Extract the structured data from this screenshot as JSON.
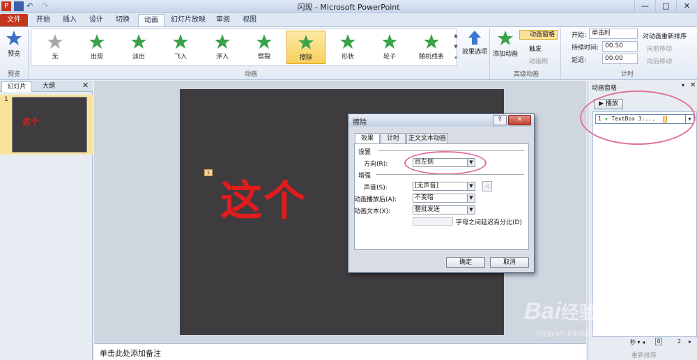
{
  "window": {
    "title": "闪现 - Microsoft PowerPoint",
    "controls": [
      "—",
      "□",
      "✕"
    ]
  },
  "tabs": [
    {
      "label": "文件"
    },
    {
      "label": "开始"
    },
    {
      "label": "插入"
    },
    {
      "label": "设计"
    },
    {
      "label": "切换"
    },
    {
      "label": "动画"
    },
    {
      "label": "幻灯片放映"
    },
    {
      "label": "审阅"
    },
    {
      "label": "视图"
    }
  ],
  "ribbon": {
    "preview": {
      "label": "预览",
      "group": "预览"
    },
    "animations": [
      {
        "label": "无",
        "color": "#a8a8a8"
      },
      {
        "label": "出现",
        "color": "#3aa34a"
      },
      {
        "label": "淡出",
        "color": "#3aa34a"
      },
      {
        "label": "飞入",
        "color": "#3aa34a"
      },
      {
        "label": "浮入",
        "color": "#3aa34a"
      },
      {
        "label": "劈裂",
        "color": "#3aa34a"
      },
      {
        "label": "擦除",
        "color": "#3aa34a"
      },
      {
        "label": "形状",
        "color": "#3aa34a"
      },
      {
        "label": "轮子",
        "color": "#3aa34a"
      },
      {
        "label": "随机线条",
        "color": "#3aa34a"
      }
    ],
    "animation_group": "动画",
    "effect_options": "效果选项",
    "add_animation": "添加动画",
    "animation_pane": "动画窗格",
    "trigger": "触发",
    "animation_painter": "动画刷",
    "advanced_group": "高级动画",
    "start_label": "开始:",
    "start_value": "单击时",
    "duration_label": "持续时间:",
    "duration_value": "00.50",
    "delay_label": "延迟:",
    "delay_value": "00.00",
    "timing_group": "计时",
    "reorder": "对动画重新排序",
    "move_earlier": "向前移动",
    "move_later": "向后移动"
  },
  "left_pane": {
    "tab_slides": "幻灯片",
    "tab_outline": "大纲",
    "slide_num": "1",
    "thumb_text": "这个"
  },
  "slide": {
    "text": "这个",
    "tag": "1"
  },
  "notes": {
    "placeholder": "单击此处添加备注"
  },
  "anim_pane": {
    "title": "动画窗格",
    "play": "播放",
    "item_num": "1",
    "item_label": "TextBox 3:...",
    "seconds": "秒",
    "scale_start": "0",
    "scale_mid": "2",
    "reorder": "重新排序"
  },
  "dialog": {
    "title": "擦除",
    "tabs": [
      "效果",
      "计时",
      "正文文本动画"
    ],
    "settings": "设置",
    "direction_label": "方向(R):",
    "direction_value": "自左侧",
    "enhance": "增强",
    "sound_label": "声音(S):",
    "sound_value": "[无声音]",
    "after_label": "动画播放后(A):",
    "after_value": "不变暗",
    "text_label": "动画文本(X):",
    "text_value": "整批发送",
    "letter_delay": "字母之间延迟百分比(D)",
    "ok": "确定",
    "cancel": "取消"
  },
  "watermark": {
    "brand": "Bai",
    "brand_suffix": "经验",
    "url": "jingyan.baidu.com"
  }
}
